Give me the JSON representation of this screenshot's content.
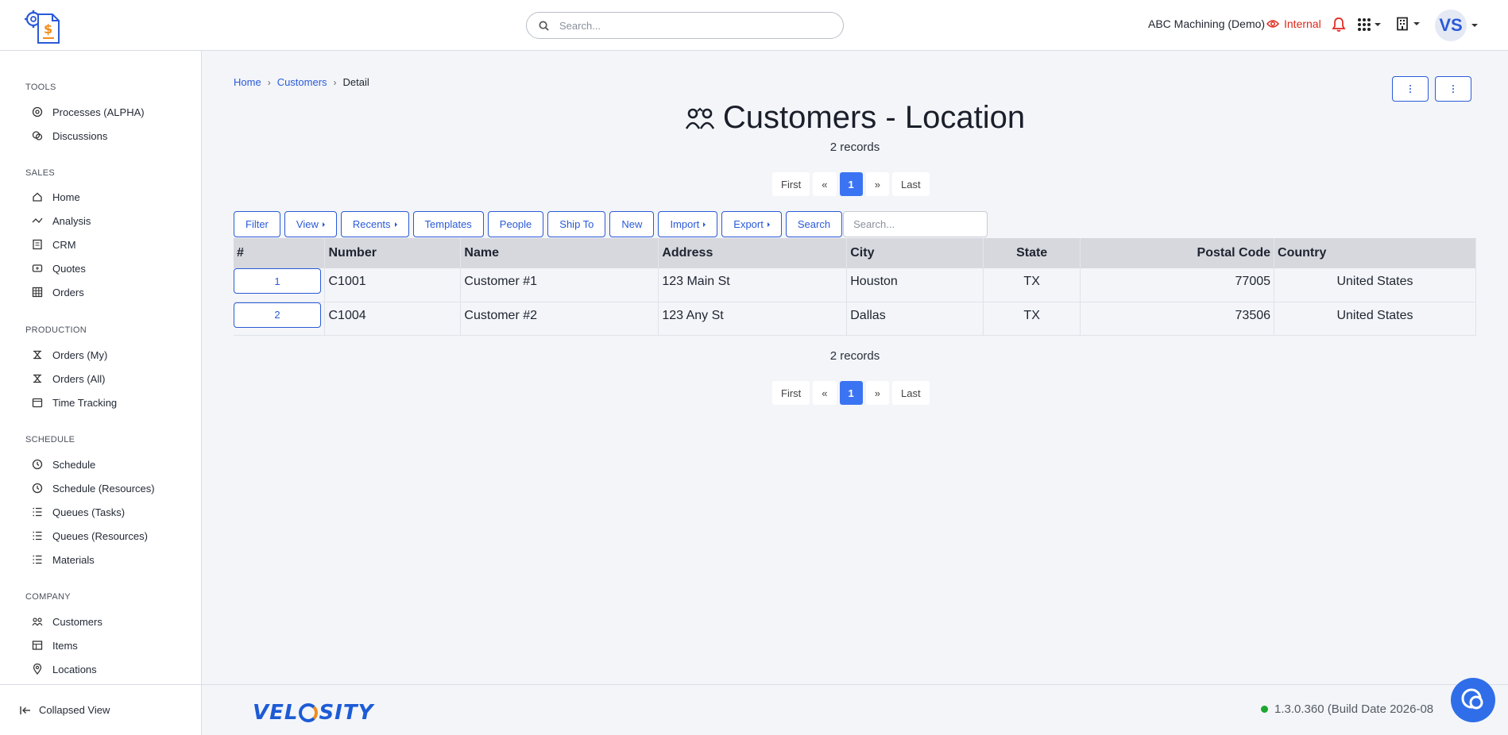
{
  "header": {
    "search_placeholder": "Search...",
    "tenant": "ABC Machining (Demo)",
    "internal_label": "Internal",
    "avatar_initials": "VS"
  },
  "sidebar": {
    "sections": [
      {
        "title": "TOOLS",
        "items": [
          {
            "label": "Processes (ALPHA)",
            "icon": "process-icon"
          },
          {
            "label": "Discussions",
            "icon": "discussion-icon"
          }
        ]
      },
      {
        "title": "SALES",
        "items": [
          {
            "label": "Home",
            "icon": "home-icon"
          },
          {
            "label": "Analysis",
            "icon": "trend-icon"
          },
          {
            "label": "CRM",
            "icon": "crm-icon"
          },
          {
            "label": "Quotes",
            "icon": "quote-icon"
          },
          {
            "label": "Orders",
            "icon": "grid-icon"
          }
        ]
      },
      {
        "title": "PRODUCTION",
        "items": [
          {
            "label": "Orders (My)",
            "icon": "production-icon"
          },
          {
            "label": "Orders (All)",
            "icon": "production-icon"
          },
          {
            "label": "Time Tracking",
            "icon": "calendar-icon"
          }
        ]
      },
      {
        "title": "SCHEDULE",
        "items": [
          {
            "label": "Schedule",
            "icon": "clock-icon"
          },
          {
            "label": "Schedule (Resources)",
            "icon": "clock-icon"
          },
          {
            "label": "Queues (Tasks)",
            "icon": "list-icon"
          },
          {
            "label": "Queues (Resources)",
            "icon": "list-icon"
          },
          {
            "label": "Materials",
            "icon": "list-icon"
          }
        ]
      },
      {
        "title": "COMPANY",
        "items": [
          {
            "label": "Customers",
            "icon": "customers-icon"
          },
          {
            "label": "Items",
            "icon": "items-icon"
          },
          {
            "label": "Locations",
            "icon": "location-icon"
          }
        ]
      }
    ],
    "collapse_label": "Collapsed View"
  },
  "breadcrumb": {
    "home": "Home",
    "customers": "Customers",
    "current": "Detail"
  },
  "page": {
    "title": "Customers - Location",
    "records_top": "2 records",
    "records_bottom": "2 records"
  },
  "pager": {
    "first": "First",
    "prev": "«",
    "current": "1",
    "next": "»",
    "last": "Last"
  },
  "toolbar": {
    "filter": "Filter",
    "view": "View",
    "recents": "Recents",
    "templates": "Templates",
    "people": "People",
    "ship_to": "Ship To",
    "new": "New",
    "import": "Import",
    "export": "Export",
    "search": "Search",
    "search_placeholder": "Search..."
  },
  "table": {
    "columns": [
      "#",
      "Number",
      "Name",
      "Address",
      "City",
      "State",
      "Postal Code",
      "Country"
    ],
    "rows": [
      [
        "1",
        "C1001",
        "Customer #1",
        "123 Main St",
        "Houston",
        "TX",
        "77005",
        "United States"
      ],
      [
        "2",
        "C1004",
        "Customer #2",
        "123 Any St",
        "Dallas",
        "TX",
        "73506",
        "United States"
      ]
    ]
  },
  "footer": {
    "brand_left": "VEL",
    "brand_right": "SITY",
    "version": "1.3.0.360 (Build Date 2026-08"
  },
  "colors": {
    "accent": "#2a5ad7",
    "active_page": "#3b74f2",
    "internal": "#e0261b",
    "status_ok": "#1ea62f"
  }
}
